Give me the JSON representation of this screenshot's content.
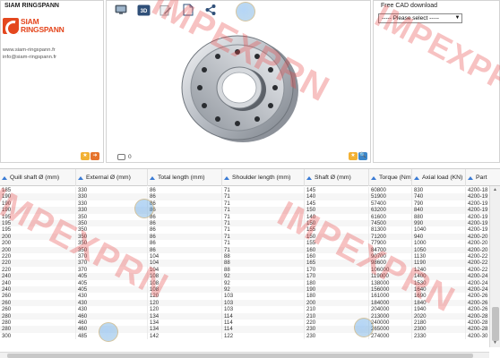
{
  "brand": {
    "panel_title": "SIAM RINGSPANN",
    "logo_line1": "SIAM",
    "logo_line2": "RINGSPANN",
    "website": "www.siam-ringspann.fr",
    "email": "info@siam-ringspann.fr"
  },
  "toolbar": {
    "icons": [
      "monitor-icon",
      "3d-icon",
      "edit-icon",
      "document-icon",
      "share-icon"
    ],
    "label_3d": "3D"
  },
  "preview": {
    "comment_count": "0"
  },
  "cad": {
    "title": "Free CAD download",
    "select_value": "----- Please select -----",
    "caret": "▼"
  },
  "table": {
    "columns": [
      "Quill shaft Ø (mm)",
      "External Ø (mm)",
      "Total length (mm)",
      "Shoulder length (mm)",
      "Shaft Ø (mm)",
      "Torque (Nm)",
      "Axial load (KN)",
      "Part"
    ],
    "rows": [
      [
        "185",
        "330",
        "86",
        "71",
        "145",
        "60800",
        "830",
        "4200-18"
      ],
      [
        "190",
        "330",
        "86",
        "71",
        "140",
        "51900",
        "740",
        "4200-19"
      ],
      [
        "190",
        "330",
        "86",
        "71",
        "145",
        "57400",
        "790",
        "4200-19"
      ],
      [
        "190",
        "330",
        "86",
        "71",
        "150",
        "63200",
        "840",
        "4200-19"
      ],
      [
        "195",
        "350",
        "86",
        "71",
        "140",
        "61600",
        "880",
        "4200-19"
      ],
      [
        "195",
        "350",
        "86",
        "71",
        "150",
        "74500",
        "990",
        "4200-19"
      ],
      [
        "195",
        "350",
        "86",
        "71",
        "155",
        "81300",
        "1040",
        "4200-19"
      ],
      [
        "200",
        "350",
        "86",
        "71",
        "150",
        "71200",
        "940",
        "4200-20"
      ],
      [
        "200",
        "350",
        "86",
        "71",
        "155",
        "77900",
        "1000",
        "4200-20"
      ],
      [
        "200",
        "350",
        "86",
        "71",
        "160",
        "84700",
        "1050",
        "4200-20"
      ],
      [
        "220",
        "370",
        "104",
        "88",
        "160",
        "90700",
        "1130",
        "4200-22"
      ],
      [
        "220",
        "370",
        "104",
        "88",
        "165",
        "98600",
        "1190",
        "4200-22"
      ],
      [
        "220",
        "370",
        "104",
        "88",
        "170",
        "106000",
        "1240",
        "4200-22"
      ],
      [
        "240",
        "405",
        "108",
        "92",
        "170",
        "119000",
        "1400",
        "4200-24"
      ],
      [
        "240",
        "405",
        "108",
        "92",
        "180",
        "138000",
        "1530",
        "4200-24"
      ],
      [
        "240",
        "405",
        "108",
        "92",
        "190",
        "156000",
        "1640",
        "4200-24"
      ],
      [
        "260",
        "430",
        "120",
        "103",
        "180",
        "161000",
        "1690",
        "4200-26"
      ],
      [
        "260",
        "430",
        "120",
        "103",
        "200",
        "184000",
        "1840",
        "4200-26"
      ],
      [
        "260",
        "430",
        "120",
        "103",
        "210",
        "204000",
        "1940",
        "4200-26"
      ],
      [
        "280",
        "460",
        "134",
        "114",
        "210",
        "213000",
        "2020",
        "4200-28"
      ],
      [
        "280",
        "460",
        "134",
        "114",
        "220",
        "240000",
        "2180",
        "4200-28"
      ],
      [
        "280",
        "460",
        "134",
        "114",
        "230",
        "265000",
        "2300",
        "4200-28"
      ],
      [
        "300",
        "485",
        "142",
        "122",
        "230",
        "274000",
        "2330",
        "4200-30"
      ]
    ]
  },
  "watermark": {
    "text": "IMPEXPRN"
  },
  "colors": {
    "brand": "#e4471e",
    "sort_icon": "#3a7bd5",
    "watermark": "#e84646"
  }
}
